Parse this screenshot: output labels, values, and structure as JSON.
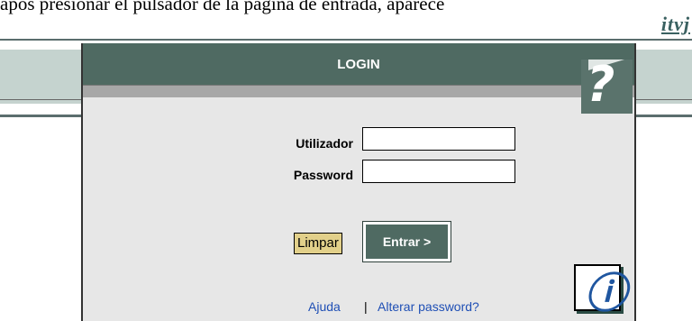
{
  "top_text": "após presionar el pulsador de la página de entrada, aparece",
  "brand": "itvj",
  "login": {
    "title": "LOGIN",
    "username_label": "Utilizador",
    "password_label": "Password",
    "username_value": "",
    "password_value": "",
    "clear_label": "Limpar",
    "submit_label": "Entrar >"
  },
  "footer": {
    "help_link": "Ajuda",
    "separator": "|",
    "change_password_link": "Alterar password?"
  },
  "icons": [
    "help-question-icon",
    "info-logo-icon"
  ],
  "colors": {
    "header": "#4f6a62",
    "band": "#c5d3cf",
    "panel": "#e7e7e7",
    "clear_button": "#e2d08a",
    "link": "#1f4fb5"
  }
}
